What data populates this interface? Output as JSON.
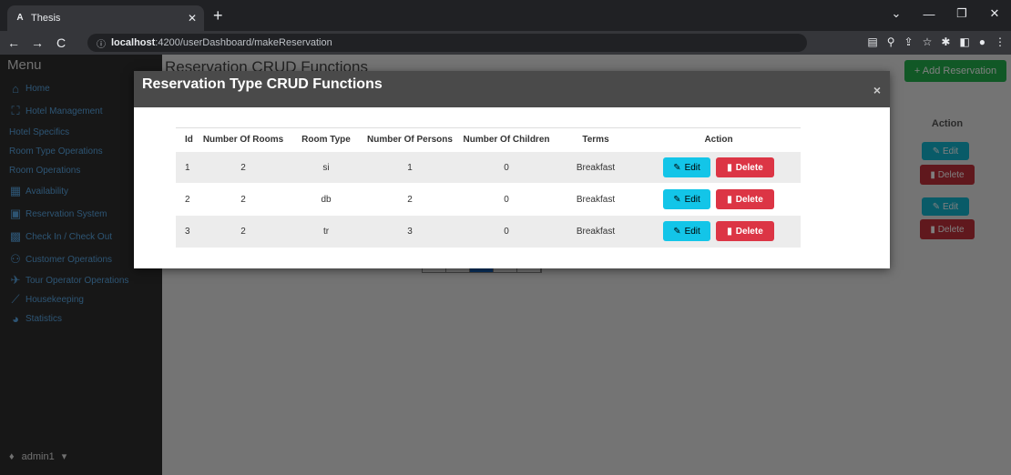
{
  "browser": {
    "tab_title": "Thesis",
    "favicon": "A",
    "url_host": "localhost",
    "url_path": ":4200/userDashboard/makeReservation"
  },
  "sidebar": {
    "menu_title": "Menu",
    "items": [
      {
        "label": "Home",
        "icon": "home-icon"
      },
      {
        "label": "Hotel Management",
        "icon": "hotel-icon"
      },
      {
        "label": "Hotel Specifics",
        "icon": ""
      },
      {
        "label": "Room Type Operations",
        "icon": ""
      },
      {
        "label": "Room Operations",
        "icon": ""
      },
      {
        "label": "Availability",
        "icon": "calendar-grid-icon"
      },
      {
        "label": "Reservation System",
        "icon": "reservation-icon"
      },
      {
        "label": "Check In / Check Out",
        "icon": "checkin-icon"
      },
      {
        "label": "Customer Operations",
        "icon": "users-icon"
      },
      {
        "label": "Tour Operator Operations",
        "icon": "plane-icon"
      },
      {
        "label": "Housekeeping",
        "icon": "broom-icon"
      },
      {
        "label": "Statistics",
        "icon": "chart-pie-icon"
      }
    ],
    "user": "admin1"
  },
  "page": {
    "title": "Reservation CRUD Functions",
    "add_button": "+ Add Reservation",
    "action_header": "Action",
    "edit_label": "Edit",
    "delete_label": "Delete"
  },
  "modal": {
    "title": "Reservation Type CRUD Functions",
    "close": "×",
    "columns": [
      "Id",
      "Number Of Rooms",
      "Room Type",
      "Number Of Persons",
      "Number Of Children",
      "Terms",
      "Action"
    ],
    "rows": [
      {
        "id": "1",
        "rooms": "2",
        "type": "si",
        "persons": "1",
        "children": "0",
        "terms": "Breakfast"
      },
      {
        "id": "2",
        "rooms": "2",
        "type": "db",
        "persons": "2",
        "children": "0",
        "terms": "Breakfast"
      },
      {
        "id": "3",
        "rooms": "2",
        "type": "tr",
        "persons": "3",
        "children": "0",
        "terms": "Breakfast"
      }
    ],
    "edit_label": "Edit",
    "delete_label": "Delete"
  },
  "colors": {
    "edit": "#13c5e8",
    "delete": "#dc3545",
    "add": "#22b14c",
    "sidebar_link": "#5aa8e6"
  }
}
